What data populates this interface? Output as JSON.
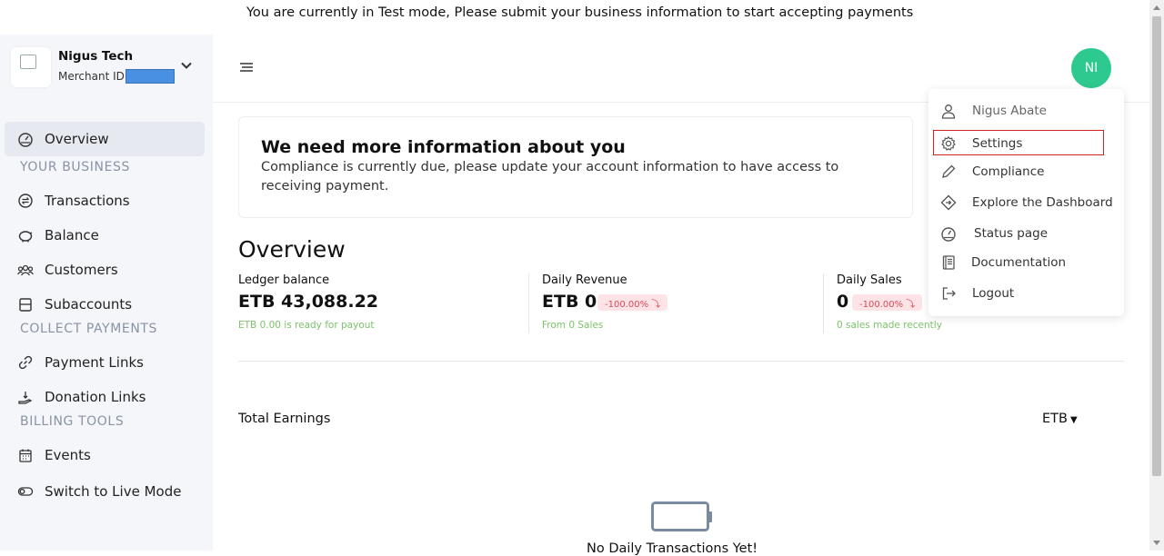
{
  "banner": {
    "text": "You are currently in Test mode, Please submit your business information to start accepting payments"
  },
  "merchant": {
    "name": "Nigus Tech",
    "id_label": "Merchant ID:",
    "id_value": ""
  },
  "sidebar": {
    "items": [
      {
        "label": "Overview",
        "icon": "dashboard-icon"
      },
      {
        "label": "Transactions",
        "icon": "exchange-icon"
      },
      {
        "label": "Balance",
        "icon": "piggy-bank-icon"
      },
      {
        "label": "Customers",
        "icon": "users-icon"
      },
      {
        "label": "Subaccounts",
        "icon": "subaccounts-icon"
      },
      {
        "label": "Payment Links",
        "icon": "link-icon"
      },
      {
        "label": "Donation Links",
        "icon": "donation-icon"
      },
      {
        "label": "Events",
        "icon": "calendar-icon"
      },
      {
        "label": "Switch to Live Mode",
        "icon": "toggle-icon"
      }
    ],
    "sections": {
      "your_business": "YOUR BUSINESS",
      "collect_payments": "COLLECT PAYMENTS",
      "billing_tools": "BILLING TOOLS"
    }
  },
  "header": {
    "avatar_initials": "NI"
  },
  "notice": {
    "title": "We need more information about you",
    "body": "Compliance is currently due, please update your account information to have access to receiving payment."
  },
  "overview": {
    "title": "Overview",
    "stats": [
      {
        "label": "Ledger balance",
        "value": "ETB 43,088.22",
        "badge": "",
        "sub": "ETB 0.00 is ready for payout"
      },
      {
        "label": "Daily Revenue",
        "value": "ETB 0",
        "badge": "-100.00% ⤵",
        "sub": "From 0 Sales"
      },
      {
        "label": "Daily Sales",
        "value": "0",
        "badge": "-100.00% ⤵",
        "sub": "0 sales made recently"
      }
    ]
  },
  "earnings": {
    "title": "Total Earnings",
    "currency": "ETB",
    "empty_text": "No Daily Transactions Yet!"
  },
  "user_menu": {
    "items": [
      {
        "label": "Nigus Abate",
        "icon": "user-icon"
      },
      {
        "label": "Settings",
        "icon": "gear-icon"
      },
      {
        "label": "Compliance",
        "icon": "pencil-icon"
      },
      {
        "label": "Explore the Dashboard",
        "icon": "diamond-icon"
      },
      {
        "label": "Status page",
        "icon": "gauge-icon"
      },
      {
        "label": "Documentation",
        "icon": "book-icon"
      },
      {
        "label": "Logout",
        "icon": "logout-icon"
      }
    ]
  },
  "colors": {
    "accent": "#2dc98e",
    "badge_bg": "#fde3e5",
    "badge_text": "#d94a5a",
    "sub_text": "#7bc36a",
    "highlight_border": "#d02424"
  }
}
